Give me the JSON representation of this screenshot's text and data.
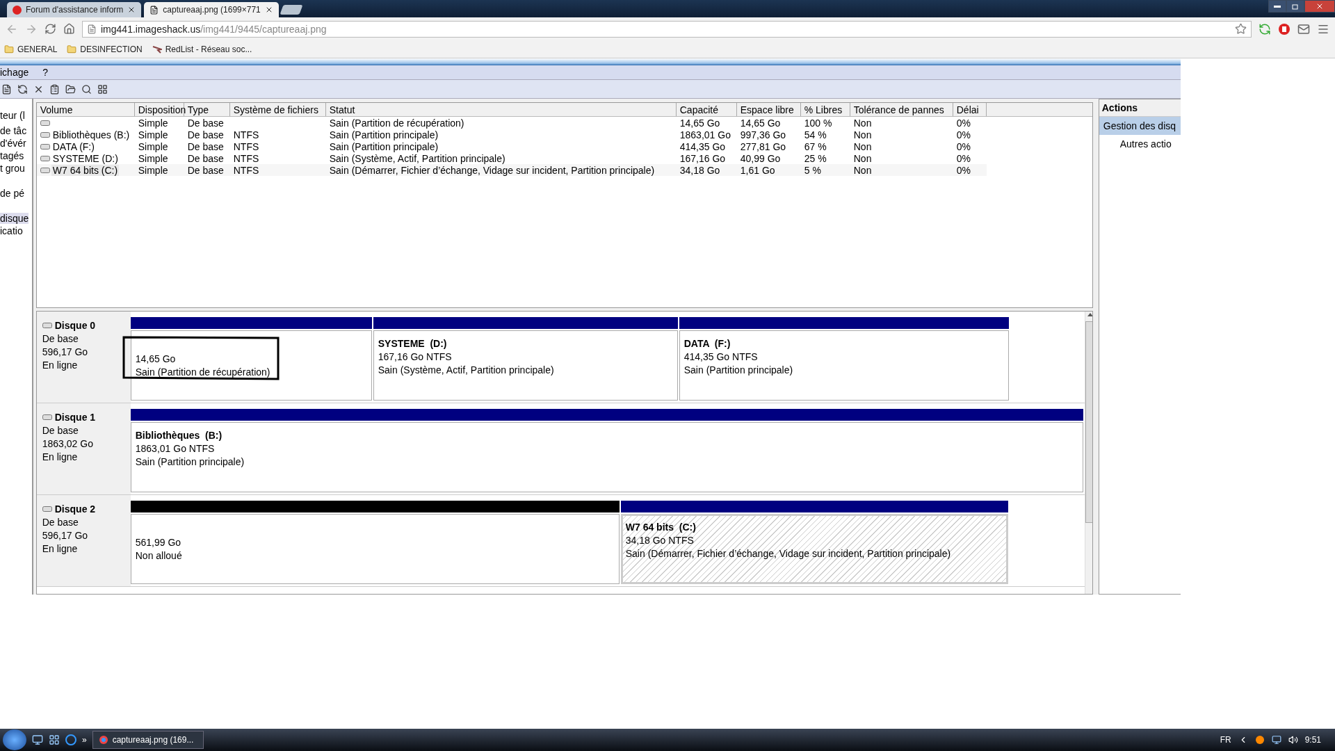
{
  "browser": {
    "tabs": [
      {
        "title": "Forum d'assistance inform",
        "selected": false
      },
      {
        "title": "captureaaj.png (1699×771",
        "selected": true
      }
    ],
    "address": {
      "host": "img441.imageshack.us",
      "path": "/img441/9445/captureaaj.png"
    },
    "bookmarks": [
      {
        "label": "GENERAL",
        "kind": "folder"
      },
      {
        "label": "DESINFECTION",
        "kind": "folder"
      },
      {
        "label": "RedList - Réseau soc...",
        "kind": "site"
      }
    ]
  },
  "app": {
    "menu": [
      "ichage",
      "?"
    ],
    "tree": [
      {
        "label": "teur (l",
        "selected": false
      },
      {
        "label": "de tâc",
        "selected": false
      },
      {
        "label": "d'évér",
        "selected": false
      },
      {
        "label": "tagés",
        "selected": false
      },
      {
        "label": "t grou",
        "selected": false
      },
      {
        "label": "de pé",
        "selected": false
      },
      {
        "label": "disque",
        "selected": true
      },
      {
        "label": "icatio",
        "selected": false
      }
    ],
    "table": {
      "columns": [
        "Volume",
        "Disposition",
        "Type",
        "Système de fichiers",
        "Statut",
        "Capacité",
        "Espace libre",
        "% Libres",
        "Tolérance de pannes",
        "Délai"
      ],
      "rows": [
        {
          "selected": false,
          "cells": [
            "",
            "Simple",
            "De base",
            "",
            "Sain (Partition de récupération)",
            "14,65 Go",
            "14,65 Go",
            "100 %",
            "Non",
            "0%"
          ]
        },
        {
          "selected": false,
          "cells": [
            "Bibliothèques (B:)",
            "Simple",
            "De base",
            "NTFS",
            "Sain (Partition principale)",
            "1863,01 Go",
            "997,36 Go",
            "54 %",
            "Non",
            "0%"
          ]
        },
        {
          "selected": false,
          "cells": [
            "DATA (F:)",
            "Simple",
            "De base",
            "NTFS",
            "Sain (Partition principale)",
            "414,35 Go",
            "277,81 Go",
            "67 %",
            "Non",
            "0%"
          ]
        },
        {
          "selected": false,
          "cells": [
            "SYSTEME (D:)",
            "Simple",
            "De base",
            "NTFS",
            "Sain (Système, Actif, Partition principale)",
            "167,16 Go",
            "40,99 Go",
            "25 %",
            "Non",
            "0%"
          ]
        },
        {
          "selected": true,
          "cells": [
            "W7 64 bits (C:)",
            "Simple",
            "De base",
            "NTFS",
            "Sain (Démarrer, Fichier d’échange, Vidage sur incident, Partition principale)",
            "34,18 Go",
            "1,61 Go",
            "5 %",
            "Non",
            "0%"
          ]
        }
      ]
    },
    "actions": {
      "title": "Actions",
      "items": [
        {
          "label": "Gestion des disq",
          "selected": true
        },
        {
          "label": "Autres actio",
          "selected": false
        }
      ]
    },
    "disks": [
      {
        "name": "Disque 0",
        "type": "De base",
        "size": "596,17 Go",
        "status": "En ligne",
        "partitions": [
          {
            "kind": "primary",
            "size": "14,65 Go",
            "status": "Sain (Partition de récupération)",
            "selected": false,
            "annotated": true
          },
          {
            "kind": "primary",
            "name": "SYSTEME  (D:)",
            "size": "167,16 Go NTFS",
            "status": "Sain (Système, Actif, Partition principale)",
            "selected": false,
            "annotated": false
          },
          {
            "kind": "primary",
            "name": "DATA  (F:)",
            "size": "414,35 Go NTFS",
            "status": "Sain (Partition principale)",
            "selected": false,
            "annotated": false
          }
        ]
      },
      {
        "name": "Disque 1",
        "type": "De base",
        "size": "1863,02 Go",
        "status": "En ligne",
        "partitions": [
          {
            "kind": "primary",
            "name": "Bibliothèques  (B:)",
            "size": "1863,01 Go NTFS",
            "status": "Sain (Partition principale)",
            "selected": false,
            "annotated": false
          }
        ]
      },
      {
        "name": "Disque 2",
        "type": "De base",
        "size": "596,17 Go",
        "status": "En ligne",
        "partitions": [
          {
            "kind": "unallocated",
            "size": "561,99 Go",
            "status": "Non alloué",
            "selected": false,
            "annotated": false
          },
          {
            "kind": "primary",
            "name": "W7 64 bits  (C:)",
            "size": "34,18 Go NTFS",
            "status": "Sain (Démarrer, Fichier d’échange, Vidage sur incident, Partition principale)",
            "selected": true,
            "annotated": false
          }
        ]
      }
    ]
  },
  "taskbar": {
    "overflow": "»",
    "window": "captureaaj.png (169...",
    "language": "FR",
    "time": "9:51"
  }
}
